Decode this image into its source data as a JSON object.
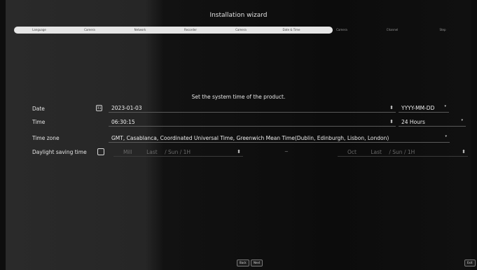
{
  "window_title": "Installation wizard",
  "steps": [
    {
      "label": "Language",
      "state": "done"
    },
    {
      "label": "Camera",
      "state": "done"
    },
    {
      "label": "Network",
      "state": "done"
    },
    {
      "label": "Recorder",
      "state": "done"
    },
    {
      "label": "Camera",
      "state": "done"
    },
    {
      "label": "Date & Time",
      "state": "current"
    },
    {
      "label": "Camera",
      "state": "todo"
    },
    {
      "label": "Channel",
      "state": "todo"
    },
    {
      "label": "Step",
      "state": "todo"
    }
  ],
  "section_title": "Set the system time of the product.",
  "date": {
    "label": "Date",
    "value": "2023-01-03",
    "format": "YYYY-MM-DD"
  },
  "time": {
    "label": "Time",
    "value": "06:30:15",
    "format": "24 Hours"
  },
  "timezone": {
    "label": "Time zone",
    "value": "GMT, Casablanca, Coordinated Universal Time, Greenwich Mean Time(Dublin, Edinburgh, Lisbon, London)"
  },
  "dst": {
    "label": "Daylight saving time",
    "checked": false,
    "start": {
      "time": "Mill",
      "week": "Last",
      "day": "/ Sun / 1H"
    },
    "end": {
      "time": "Oct",
      "week": "Last",
      "day": "/ Sun / 1H"
    },
    "separator": "~"
  },
  "footer": {
    "back": "Back",
    "next": "Next",
    "exit": "Exit"
  }
}
